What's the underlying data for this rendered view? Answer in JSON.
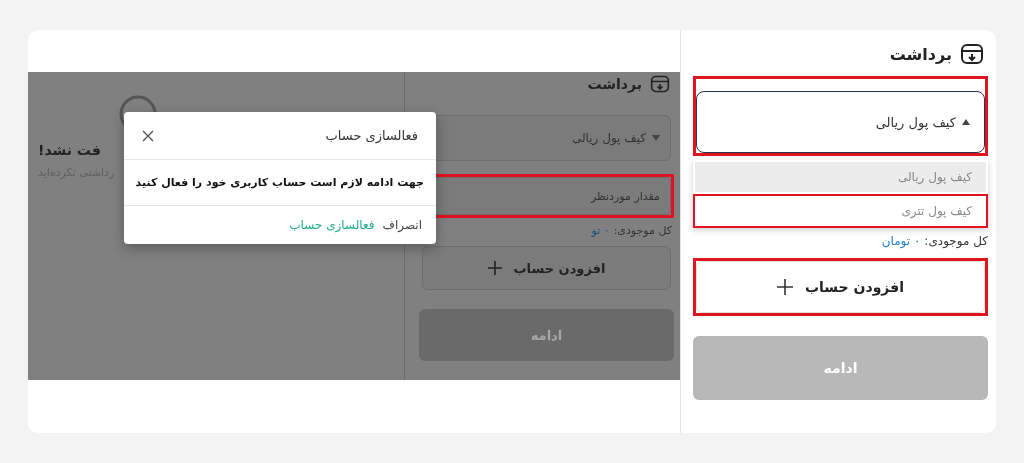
{
  "left_screenshot": {
    "title": "برداشت",
    "wallet_dropdown": {
      "value": "کیف پول ریالی",
      "expanded": false,
      "highlighted": false
    },
    "amount_field": {
      "placeholder": "مقدار موردنظر",
      "highlighted": true
    },
    "balance": {
      "label": "کل موجودی:",
      "value": "۰ تو"
    },
    "add_account_button": {
      "label": "افزودن حساب",
      "highlighted": false
    },
    "continue_button": {
      "label": "ادامه",
      "disabled": true
    },
    "empty_state": {
      "heading": "فت نشد!",
      "text": "رداشتی نکرده‌اید"
    },
    "modal": {
      "title": "فعالسازی حساب",
      "message": "جهت ادامه لازم است حساب کاربری خود را فعال کنید",
      "buttons": [
        {
          "label": "انصراف",
          "kind": "secondary"
        },
        {
          "label": "فعالسازی حساب",
          "kind": "primary"
        }
      ]
    }
  },
  "right_screenshot": {
    "title": "برداشت",
    "wallet_dropdown": {
      "value": "کیف پول ریالی",
      "expanded": true,
      "highlighted": true
    },
    "options": [
      {
        "label": "کیف پول ریالی",
        "selected": true,
        "highlighted": false
      },
      {
        "label": "کیف پول تتری",
        "selected": false,
        "highlighted": true
      }
    ],
    "balance": {
      "label": "کل موجودی:",
      "value": "۰ تومان"
    },
    "add_account_button": {
      "label": "افزودن حساب",
      "highlighted": true
    },
    "continue_button": {
      "label": "ادامه",
      "disabled": true
    }
  }
}
